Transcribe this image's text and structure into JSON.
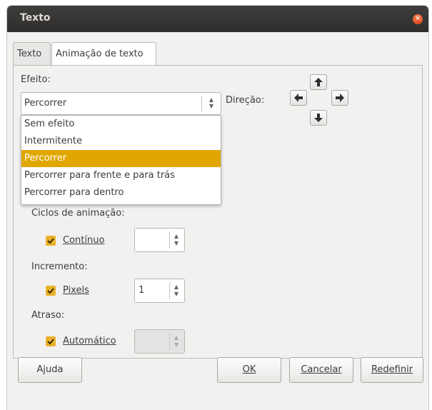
{
  "window": {
    "title": "Texto"
  },
  "tabs": [
    {
      "label": "Texto"
    },
    {
      "label": "Animação de texto"
    }
  ],
  "effect": {
    "label": "Efeito:",
    "selected": "Percorrer",
    "options": [
      "Sem efeito",
      "Intermitente",
      "Percorrer",
      "Percorrer para frente e para trás",
      "Percorrer para dentro"
    ]
  },
  "direction": {
    "label": "Direção:"
  },
  "cycles": {
    "label": "Ciclos de animação:",
    "checkbox_label": "Contínuo",
    "checked": true,
    "value": ""
  },
  "increment": {
    "label": "Incremento:",
    "checkbox_label": "Pixels",
    "checked": true,
    "value": "1"
  },
  "delay": {
    "label": "Atraso:",
    "checkbox_label": "Automático",
    "checked": true,
    "value": ""
  },
  "buttons": {
    "help": "Ajuda",
    "ok": "OK",
    "cancel": "Cancelar",
    "reset": "Redefinir"
  },
  "colors": {
    "accent": "#e0a700",
    "titlebar": "#3a3937"
  }
}
